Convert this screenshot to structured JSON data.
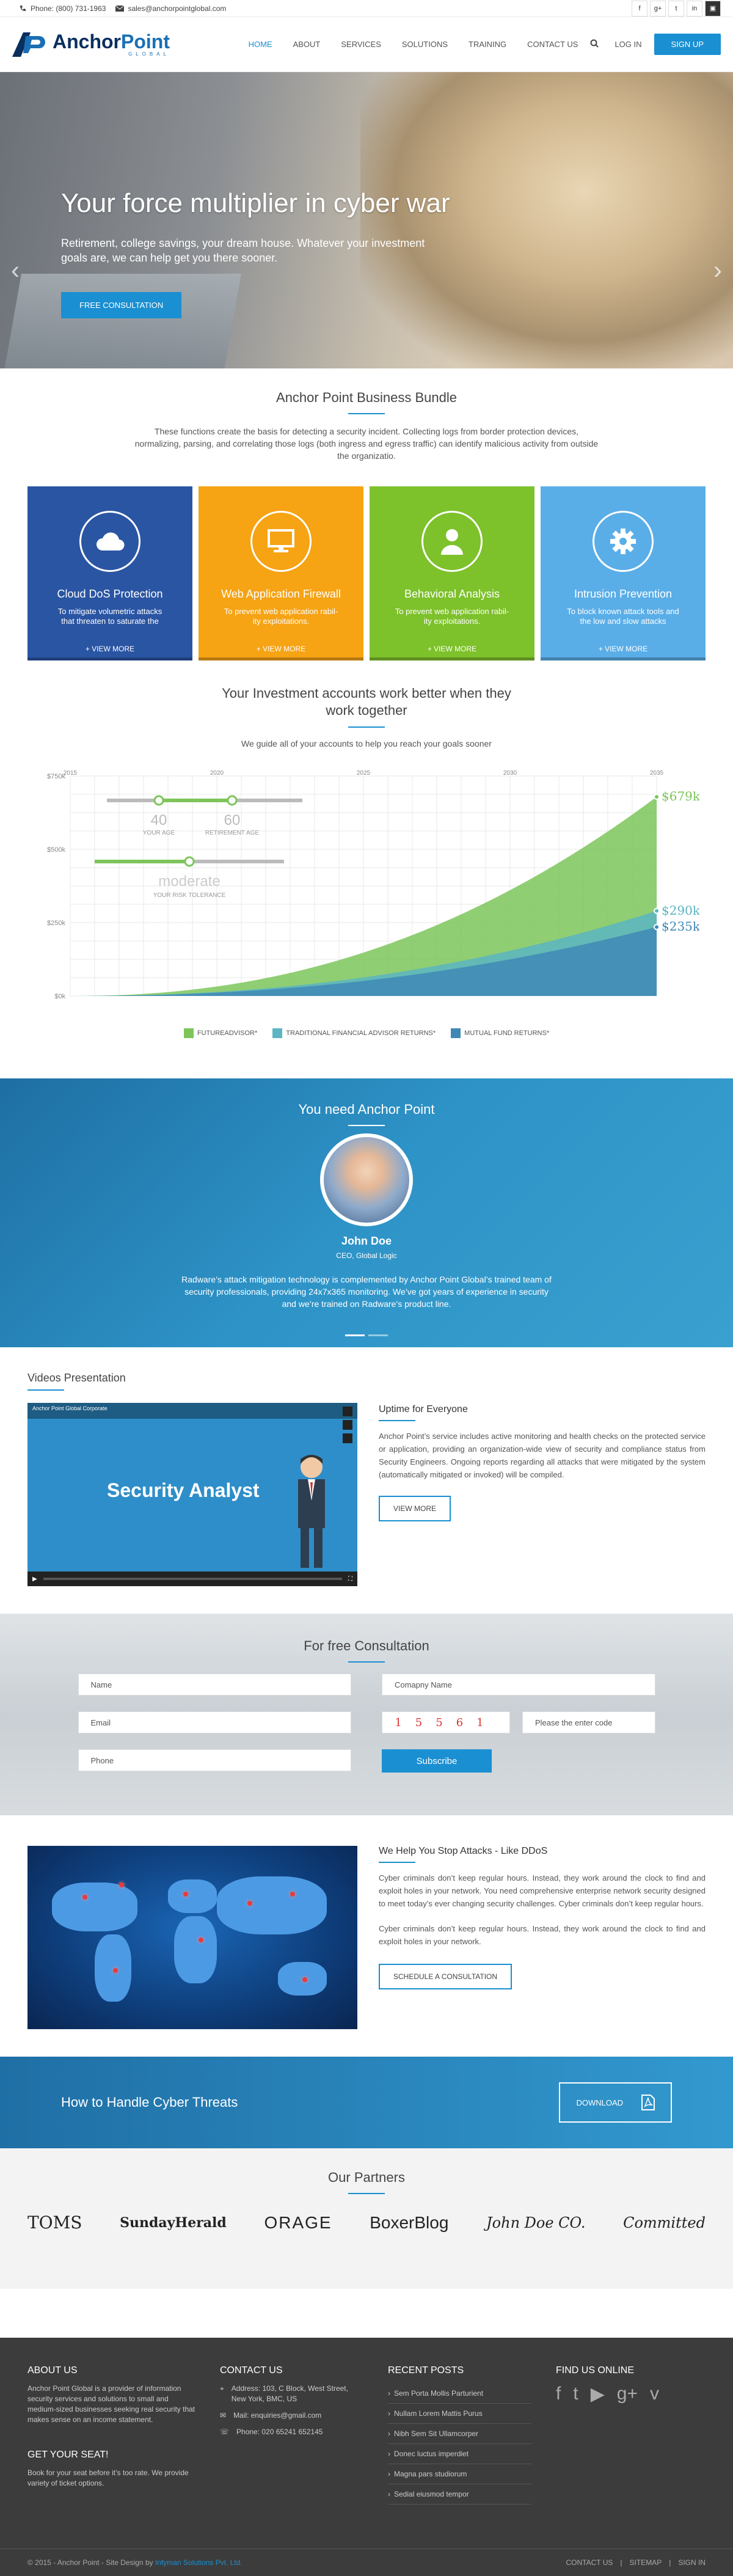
{
  "topbar": {
    "phone": "Phone: (800) 731-1963",
    "email": "sales@anchorpointglobal.com",
    "social": [
      "f",
      "g+",
      "t",
      "in",
      "▣"
    ]
  },
  "brand": {
    "name_a": "Anchor",
    "name_b": "Point",
    "tagline": "GLOBAL"
  },
  "nav": {
    "items": [
      "HOME",
      "ABOUT",
      "SERVICES",
      "SOLUTIONS",
      "TRAINING",
      "CONTACT US"
    ],
    "login": "LOG IN",
    "signup": "SIGN UP"
  },
  "hero": {
    "title": "Your force multiplier in cyber war",
    "subtitle": "Retirement, college savings, your dream house. Whatever your investment goals are, we can help get you there sooner.",
    "button": "FREE CONSULTATION"
  },
  "bundle": {
    "title": "Anchor Point Business Bundle",
    "intro": "These functions create the basis for detecting a security incident. Collecting logs from border protection devices, normalizing, parsing, and correlating those logs (both ingress and egress traffic) can identify malicious activity from outside the organizatio.",
    "cards": [
      {
        "title": "Cloud DoS Protection",
        "desc": "To mitigate volumetric attacks that threaten to saturate the",
        "more": "+ VIEW MORE",
        "color": "#2a55a3"
      },
      {
        "title": "Web Application Firewall",
        "desc": "To prevent web application rabil-ity exploitations.",
        "more": "+ VIEW MORE",
        "color": "#f6a314"
      },
      {
        "title": "Behavioral Analysis",
        "desc": "To prevent web application rabil-ity exploitations.",
        "more": "+ VIEW MORE",
        "color": "#7dc12b"
      },
      {
        "title": "Intrusion Prevention",
        "desc": "To block known attack tools and the low and slow attacks",
        "more": "+ VIEW MORE",
        "color": "#5aaee8"
      }
    ]
  },
  "invest": {
    "title_1": "Your Investment accounts work better when they",
    "title_2": "work together",
    "subtitle": "We guide all of your accounts to help you reach your goals sooner"
  },
  "chart_data": {
    "type": "area",
    "x": [
      2015,
      2020,
      2025,
      2030,
      2035
    ],
    "yticks": [
      "$750k",
      "$500k",
      "$250k",
      "$0k"
    ],
    "ylim": [
      0,
      750
    ],
    "series": [
      {
        "name": "FUTUREADVISOR*",
        "end_label": "$679k",
        "color": "#7dc55a"
      },
      {
        "name": "TRADITIONAL FINANCIAL ADVISOR RETURNS*",
        "end_label": "$290k",
        "color": "#5bb5c2"
      },
      {
        "name": "MUTUAL FUND RETURNS*",
        "end_label": "$235k",
        "color": "#3f88b6"
      }
    ],
    "sliders": {
      "age": "40",
      "age_label": "YOUR AGE",
      "retire": "60",
      "retire_label": "RETIREMENT AGE",
      "risk": "moderate",
      "risk_label": "YOUR RISK TOLERANCE"
    }
  },
  "need": {
    "title": "You need Anchor Point",
    "name": "John Doe",
    "role": "CEO, Global Logic",
    "quote": "Radware’s attack mitigation technology is complemented by Anchor Point Global’s trained team of security professionals, providing 24x7x365 monitoring. We’ve got years of experience in security and we’re trained on Radware’s product line."
  },
  "videos": {
    "title": "Videos Presentation",
    "video_text": "Security Analyst",
    "video_channel": "Anchor Point Global Corporate",
    "right_title": "Uptime for Everyone",
    "right_text": "Anchor Point’s service includes active monitoring and health checks on the protected service or application, providing an organization-wide view of security and compliance status from Security Engineers. Ongoing reports regarding all attacks that were mitigated by the system (automatically mitigated or invoked) will be compiled.",
    "button": "VIEW MORE"
  },
  "consult": {
    "title": "For free Consultation",
    "name": "Name",
    "company": "Comapny Name",
    "email": "Email",
    "captcha": "15561",
    "enter": "Please the enter code",
    "phone": "Phone",
    "submit": "Subscribe"
  },
  "ddos": {
    "title": "We Help You Stop Attacks - Like DDoS",
    "p1": "Cyber criminals don’t keep regular hours. Instead, they work around the clock to find and exploit holes in your network. You need comprehensive enterprise network security designed to meet today’s ever changing security challenges. Cyber criminals don’t keep regular hours.",
    "p2": "Cyber criminals don’t keep regular hours. Instead, they work around the clock to find and exploit holes in your network.",
    "button": "SCHEDULE A CONSULTATION"
  },
  "handle": {
    "title": "How to  Handle Cyber Threats",
    "button": "DOWNLOAD"
  },
  "partners": {
    "title": "Our Partners",
    "logos": [
      "TOMS",
      "SundayHerald",
      "ORAGE",
      "BoxerBlog",
      "John Doe CO.",
      "Committed"
    ]
  },
  "footer": {
    "about_title": "ABOUT US",
    "about_text": "Anchor Point Global is a provider of information security services and solutions to small and medium-sized businesses seeking real security that makes sense on an income statement.",
    "seat_title": "GET YOUR SEAT!",
    "seat_text": "Book for your seat before it’s too rate. We provide variety of ticket options.",
    "contact_title": "CONTACT US",
    "address": "Address: 103, C Block, West Street, New York, BMC, US",
    "mail": "Mail: enquiries@gmail.com",
    "phone": "Phone: 020 65241 652145",
    "posts_title": "RECENT POSTS",
    "posts": [
      "Sem Porta Mollis Parturient",
      "Nullam Lorem Mattis Purus",
      "Nibh Sem Sit Ullamcorper",
      "Donec luctus imperdiet",
      "Magna pars studiorum",
      "Sedial eiusmod tempor"
    ],
    "online_title": "FIND US ONLINE",
    "copyright_a": "© 2015 - Anchor Point - Site Design by ",
    "copyright_b": "Infyman Solutions Pvt. Ltd.",
    "links": [
      "CONTACT US",
      "SITEMAP",
      "SIGN IN"
    ]
  }
}
